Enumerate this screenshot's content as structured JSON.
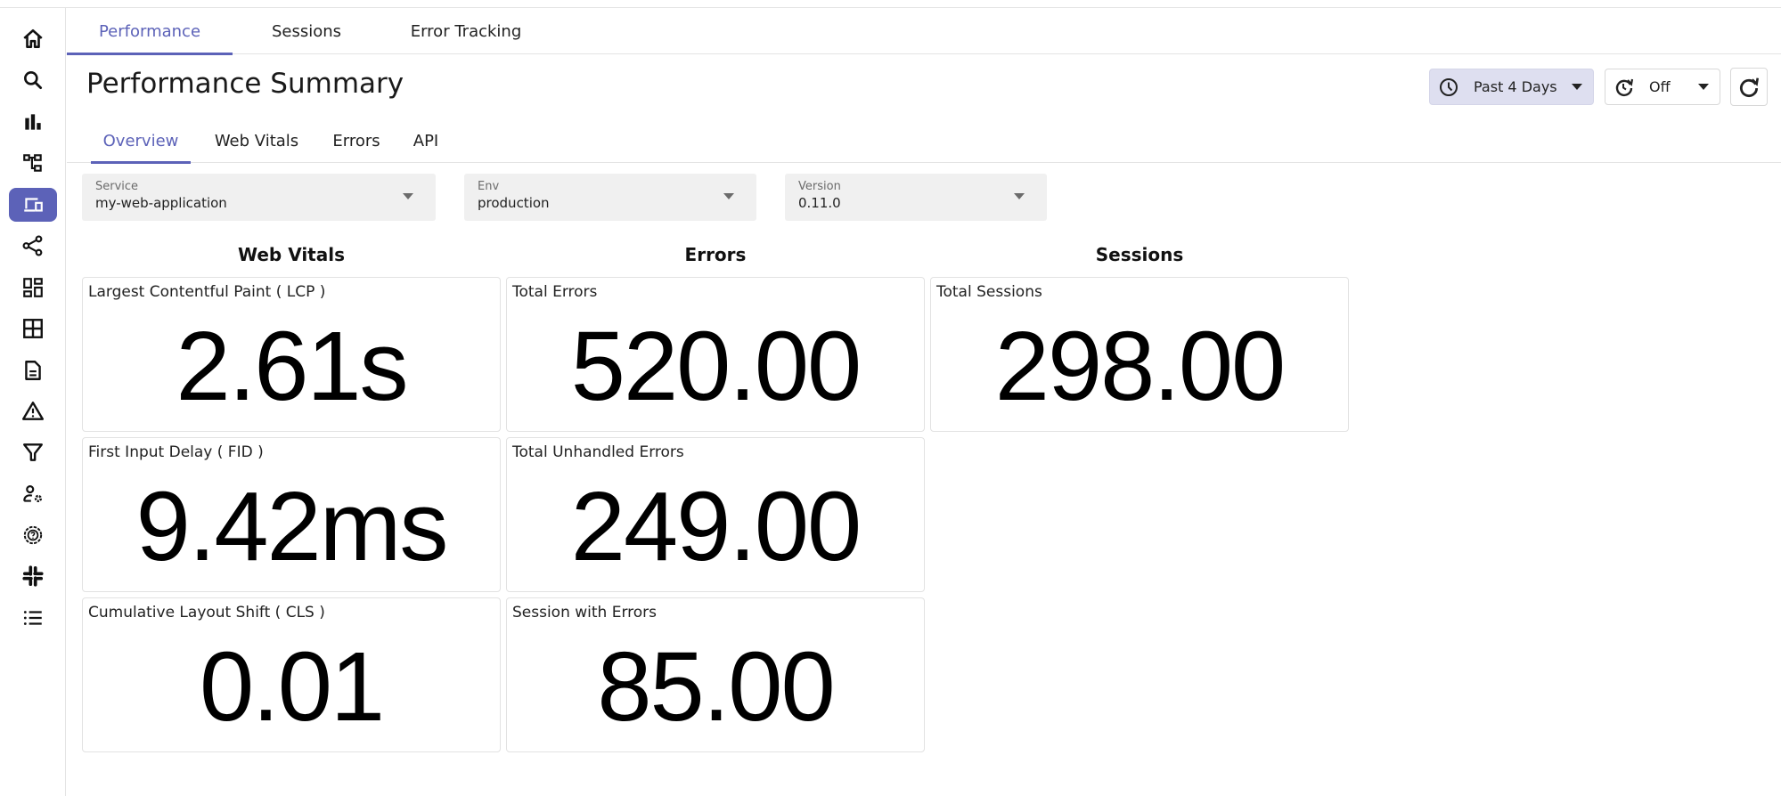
{
  "colors": {
    "accent": "#5c62b8",
    "time_range_bg": "#dedff0",
    "filter_bg": "#f0f0f0"
  },
  "sidebar": {
    "items": [
      {
        "icon": "home-icon",
        "active": false
      },
      {
        "icon": "search-icon",
        "active": false
      },
      {
        "icon": "bar-chart-icon",
        "active": false
      },
      {
        "icon": "hierarchy-icon",
        "active": false
      },
      {
        "icon": "devices-icon",
        "active": true
      },
      {
        "icon": "share-nodes-icon",
        "active": false
      },
      {
        "icon": "dashboard-icon",
        "active": false
      },
      {
        "icon": "grid-icon",
        "active": false
      },
      {
        "icon": "document-icon",
        "active": false
      },
      {
        "icon": "warning-icon",
        "active": false
      },
      {
        "icon": "filter-icon",
        "active": false
      },
      {
        "icon": "user-settings-icon",
        "active": false
      },
      {
        "icon": "help-gear-icon",
        "active": false
      },
      {
        "icon": "slack-icon",
        "active": false
      },
      {
        "icon": "list-icon",
        "active": false
      }
    ]
  },
  "top_tabs": [
    {
      "label": "Performance",
      "active": true
    },
    {
      "label": "Sessions",
      "active": false
    },
    {
      "label": "Error Tracking",
      "active": false
    }
  ],
  "page_title": "Performance Summary",
  "sub_tabs": [
    {
      "label": "Overview",
      "active": true
    },
    {
      "label": "Web Vitals",
      "active": false
    },
    {
      "label": "Errors",
      "active": false
    },
    {
      "label": "API",
      "active": false
    }
  ],
  "controls": {
    "time_range": {
      "icon": "clock-icon",
      "value": "Past 4 Days"
    },
    "auto_refresh": {
      "icon": "timer-refresh-icon",
      "value": "Off"
    },
    "refresh": {
      "icon": "refresh-icon"
    }
  },
  "filters": [
    {
      "label": "Service",
      "value": "my-web-application"
    },
    {
      "label": "Env",
      "value": "production"
    },
    {
      "label": "Version",
      "value": "0.11.0"
    }
  ],
  "columns": [
    {
      "title": "Web Vitals",
      "cards": [
        {
          "title": "Largest Contentful Paint ( LCP )",
          "value": "2.61s"
        },
        {
          "title": "First Input Delay ( FID )",
          "value": "9.42ms"
        },
        {
          "title": "Cumulative Layout Shift ( CLS )",
          "value": "0.01"
        }
      ]
    },
    {
      "title": "Errors",
      "cards": [
        {
          "title": "Total Errors",
          "value": "520.00"
        },
        {
          "title": "Total Unhandled Errors",
          "value": "249.00"
        },
        {
          "title": "Session with Errors",
          "value": "85.00"
        }
      ]
    },
    {
      "title": "Sessions",
      "cards": [
        {
          "title": "Total Sessions",
          "value": "298.00"
        }
      ]
    }
  ]
}
